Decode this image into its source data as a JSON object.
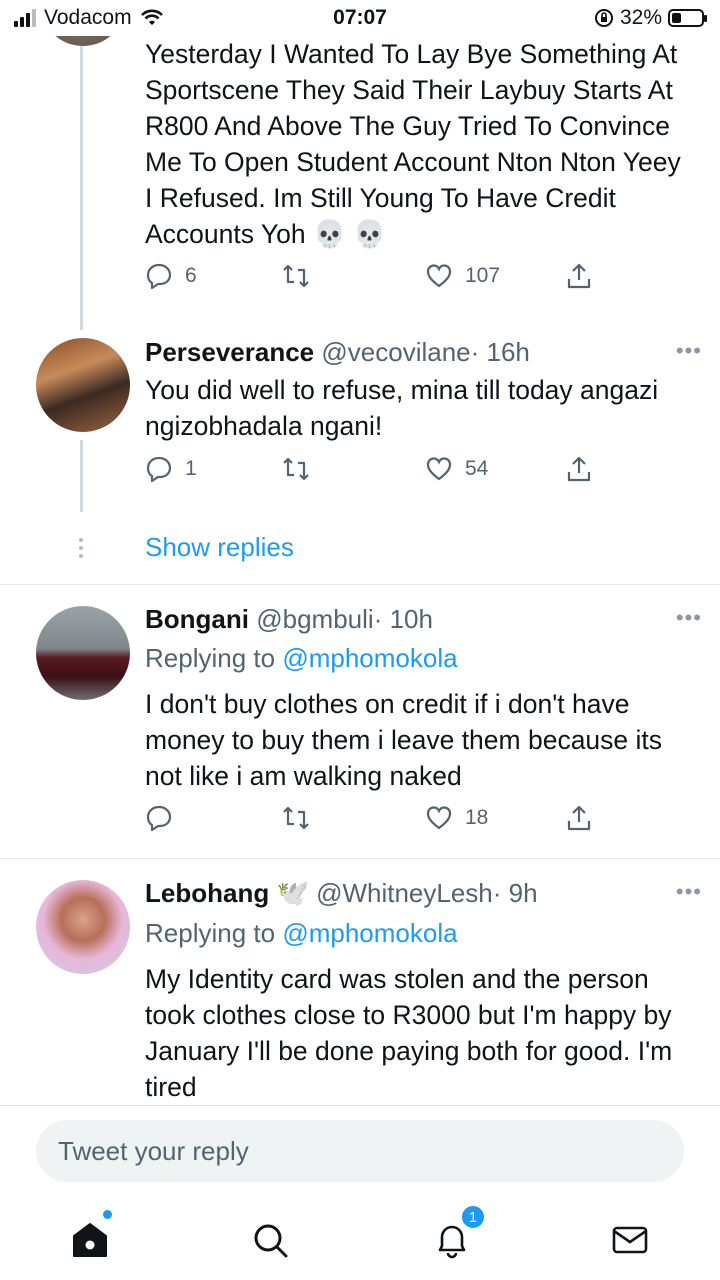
{
  "status_bar": {
    "carrier": "Vodacom",
    "time": "07:07",
    "battery": "32%",
    "battery_level": 0.32
  },
  "tweets": [
    {
      "text": "Yesterday I Wanted To Lay Bye Something At Sportscene They Said Their Laybuy Starts At R800 And Above The Guy Tried To Convince Me To Open Student Account Nton Nton Yeey I Refused. Im Still Young To Have Credit Accounts Yoh 💀 💀",
      "replies": "6",
      "likes": "107"
    },
    {
      "name": "Perseverance",
      "handle": "@vecovilane",
      "time": "· 16h",
      "text": "You did well to refuse, mina till today angazi ngizobhadala ngani!",
      "replies": "1",
      "likes": "54"
    },
    {
      "name": "Bongani",
      "handle": "@bgmbuli",
      "time": "· 10h",
      "replying_prefix": "Replying to",
      "replying_to": "@mphomokola",
      "text": "I don't buy clothes on credit if i don't  have money to buy them i leave them because its not like i am walking naked",
      "likes": "18"
    },
    {
      "name": "Lebohang",
      "name_emoji": "🕊️",
      "handle": "@WhitneyLesh",
      "time": "· 9h",
      "replying_prefix": "Replying to",
      "replying_to": "@mphomokola",
      "text": "My Identity card was stolen and the person took clothes close to R3000 but I'm happy by January I'll be done paying both for good. I'm tired"
    }
  ],
  "show_replies": "Show replies",
  "reply_bar": {
    "placeholder": "Tweet your reply"
  },
  "tab_bar": {
    "notifications_badge": "1"
  }
}
